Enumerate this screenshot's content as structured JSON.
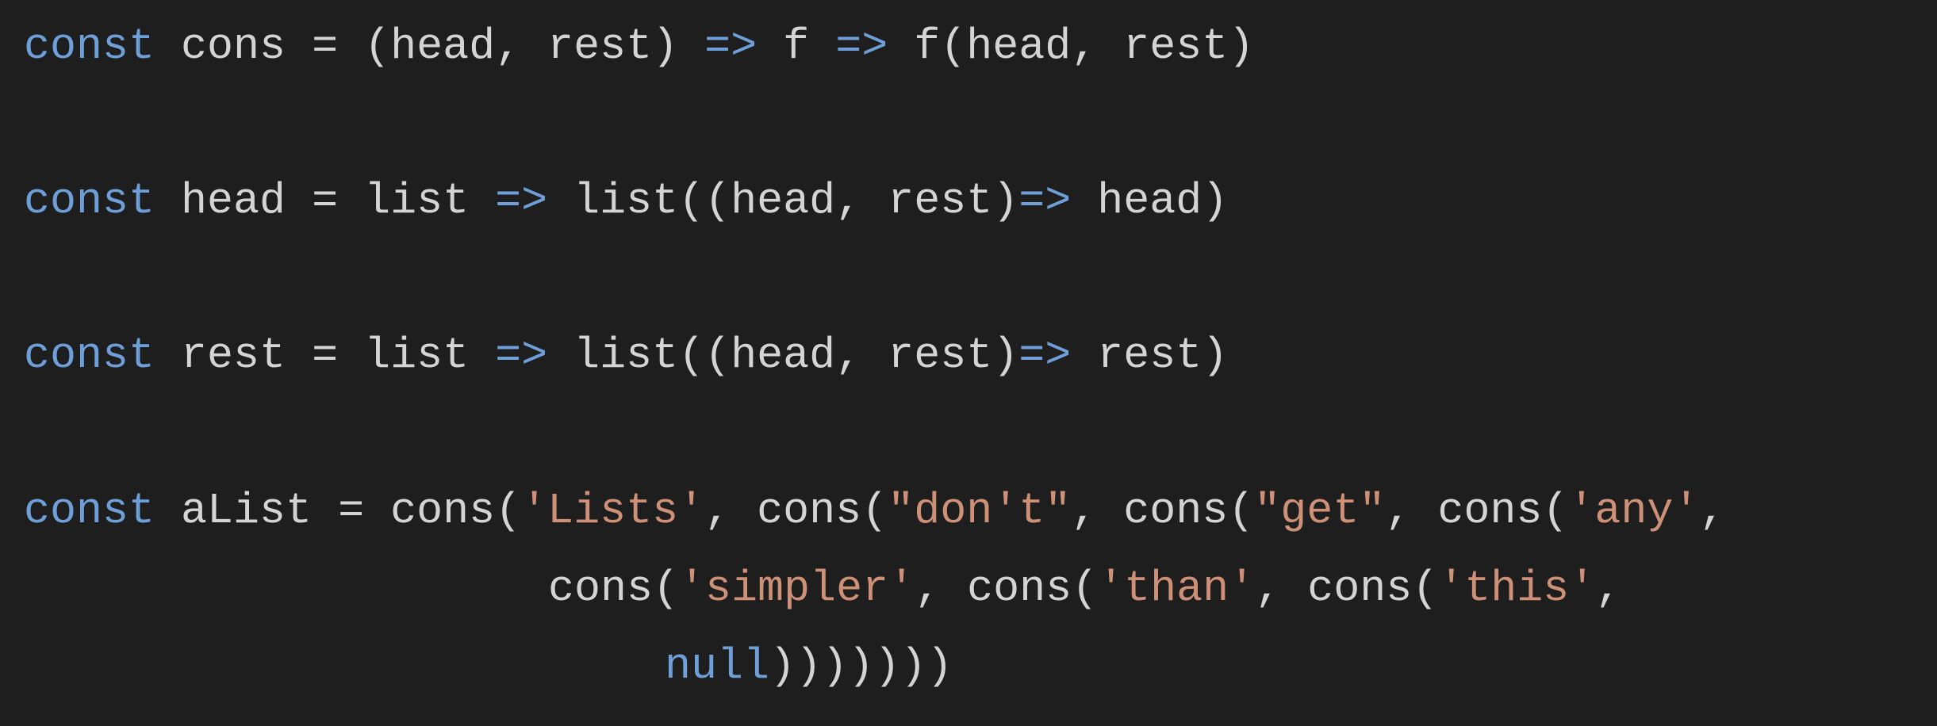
{
  "colors": {
    "background": "#1e1e1e",
    "keyword": "#6f9fd8",
    "identifier": "#d4d4d4",
    "string": "#ce9178"
  },
  "code": {
    "line1": [
      {
        "text": "const",
        "cls": "kw"
      },
      {
        "text": " cons = (head, rest) ",
        "cls": "tx"
      },
      {
        "text": "=>",
        "cls": "op"
      },
      {
        "text": " f ",
        "cls": "tx"
      },
      {
        "text": "=>",
        "cls": "op"
      },
      {
        "text": " f(head, rest)",
        "cls": "tx"
      }
    ],
    "line2": [
      {
        "text": "const",
        "cls": "kw"
      },
      {
        "text": " head = list ",
        "cls": "tx"
      },
      {
        "text": "=>",
        "cls": "op"
      },
      {
        "text": " list((head, rest)",
        "cls": "tx"
      },
      {
        "text": "=>",
        "cls": "op"
      },
      {
        "text": " head)",
        "cls": "tx"
      }
    ],
    "line3": [
      {
        "text": "const",
        "cls": "kw"
      },
      {
        "text": " rest = list ",
        "cls": "tx"
      },
      {
        "text": "=>",
        "cls": "op"
      },
      {
        "text": " list((head, rest)",
        "cls": "tx"
      },
      {
        "text": "=>",
        "cls": "op"
      },
      {
        "text": " rest)",
        "cls": "tx"
      }
    ],
    "line4": [
      {
        "text": "const",
        "cls": "kw"
      },
      {
        "text": " aList = cons(",
        "cls": "tx"
      },
      {
        "text": "'Lists'",
        "cls": "str"
      },
      {
        "text": ", cons(",
        "cls": "tx"
      },
      {
        "text": "\"don't\"",
        "cls": "str"
      },
      {
        "text": ", cons(",
        "cls": "tx"
      },
      {
        "text": "\"get\"",
        "cls": "str"
      },
      {
        "text": ", cons(",
        "cls": "tx"
      },
      {
        "text": "'any'",
        "cls": "str"
      },
      {
        "text": ",",
        "cls": "tx"
      }
    ],
    "line5": [
      {
        "text": "cons(",
        "cls": "tx"
      },
      {
        "text": "'simpler'",
        "cls": "str"
      },
      {
        "text": ", cons(",
        "cls": "tx"
      },
      {
        "text": "'than'",
        "cls": "str"
      },
      {
        "text": ", cons(",
        "cls": "tx"
      },
      {
        "text": "'this'",
        "cls": "str"
      },
      {
        "text": ",",
        "cls": "tx"
      }
    ],
    "line6": [
      {
        "text": "null",
        "cls": "nul"
      },
      {
        "text": ")))))))",
        "cls": "tx"
      }
    ]
  }
}
